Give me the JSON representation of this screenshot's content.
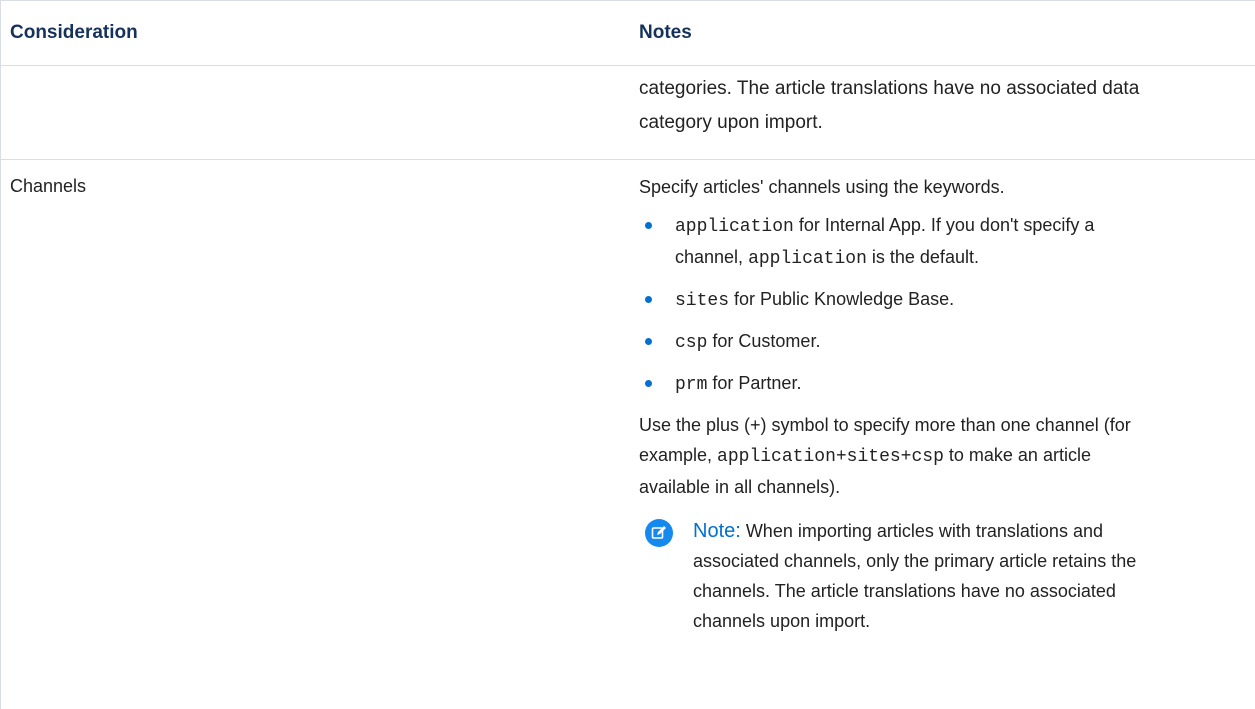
{
  "table": {
    "headers": {
      "consideration": "Consideration",
      "notes": "Notes"
    },
    "row1": {
      "notes_line1": "categories. The article translations have no associated data",
      "notes_line2": "category upon import."
    },
    "row2": {
      "consideration": "Channels",
      "intro": "Specify articles' channels using the keywords.",
      "bullets": [
        {
          "code": "application",
          "text_a": " for Internal App. If you don't specify a",
          "code2": "application",
          "text_b": " is the default.",
          "line2_prefix": "channel, "
        },
        {
          "code": "sites",
          "text": " for Public Knowledge Base."
        },
        {
          "code": "csp",
          "text": " for Customer."
        },
        {
          "code": "prm",
          "text": " for Partner."
        }
      ],
      "para_a": "Use the plus (+) symbol to specify more than one channel (for",
      "para_b_prefix": "example, ",
      "para_code": "application+sites+csp",
      "para_b_suffix": " to make an article",
      "para_c": "available in all channels).",
      "note_icon": "edit-note-icon",
      "note_label": "Note:",
      "note_line1": " When importing articles with translations and",
      "note_line2": "associated channels, only the primary article retains the",
      "note_line3": "channels. The article translations have no associated",
      "note_line4": "channels upon import."
    }
  },
  "colors": {
    "accent": "#0070d2",
    "note_icon_bg": "#1589ee",
    "header_text": "#16325c",
    "border": "#d8dde6"
  }
}
